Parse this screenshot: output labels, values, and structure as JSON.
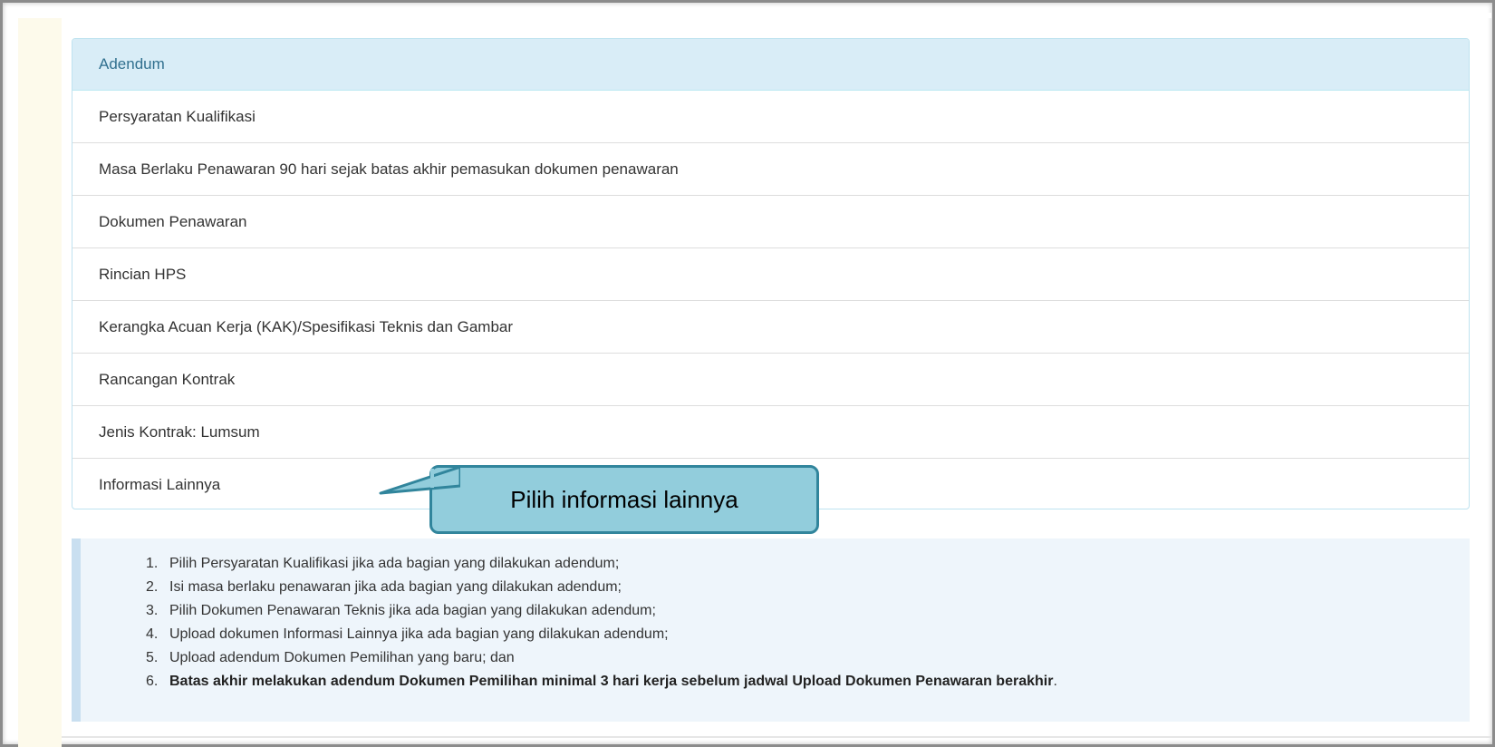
{
  "panel": {
    "heading": "Adendum",
    "items": [
      {
        "label": "Persyaratan Kualifikasi"
      },
      {
        "label": "Masa Berlaku Penawaran 90 hari sejak batas akhir pemasukan dokumen penawaran"
      },
      {
        "label": "Dokumen Penawaran"
      },
      {
        "label": "Rincian HPS"
      },
      {
        "label": "Kerangka Acuan Kerja (KAK)/Spesifikasi Teknis dan Gambar"
      },
      {
        "label": "Rancangan Kontrak"
      },
      {
        "label": "Jenis Kontrak: Lumsum"
      },
      {
        "label": "Informasi Lainnya"
      }
    ]
  },
  "callout": {
    "text": "Pilih informasi lainnya"
  },
  "info": {
    "items": [
      {
        "num": "1.",
        "text": "Pilih Persyaratan Kualifikasi jika ada bagian yang dilakukan adendum;"
      },
      {
        "num": "2.",
        "text": "Isi masa berlaku penawaran jika ada bagian yang dilakukan adendum;"
      },
      {
        "num": "3.",
        "text": "Pilih Dokumen Penawaran Teknis jika ada bagian yang dilakukan adendum;"
      },
      {
        "num": "4.",
        "text": "Upload dokumen Informasi Lainnya jika ada bagian yang dilakukan adendum;"
      },
      {
        "num": "5.",
        "text": "Upload adendum Dokumen Pemilihan yang baru; dan"
      },
      {
        "num": "6.",
        "bold": "Batas akhir melakukan adendum Dokumen Pemilihan minimal 3 hari kerja sebelum jadwal Upload Dokumen Penawaran berakhir",
        "suffix": "."
      }
    ]
  },
  "colors": {
    "heading_bg": "#d9edf7",
    "heading_text": "#31708f",
    "callout_fill": "#92cddc",
    "callout_border": "#31859c",
    "info_bg": "#eef5fb"
  }
}
